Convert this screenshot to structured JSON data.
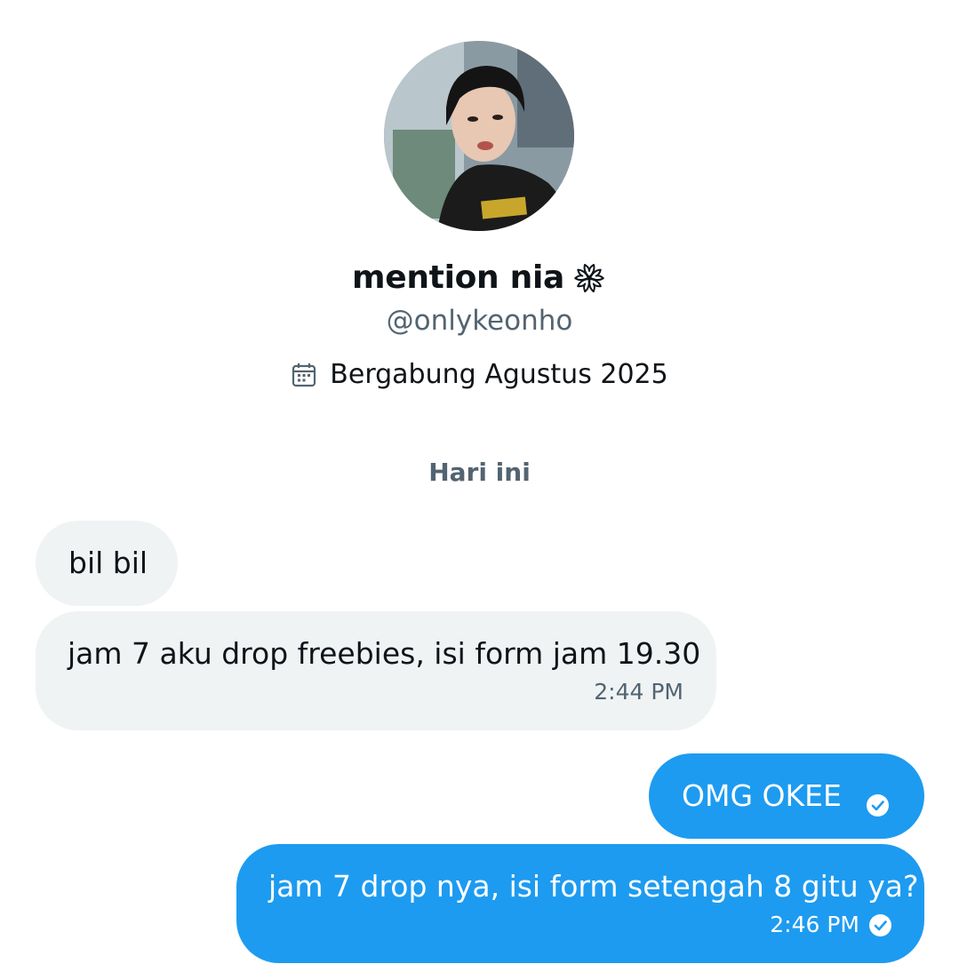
{
  "profile": {
    "display_name": "mention nia",
    "name_emoji_icon": "flower-icon",
    "handle": "@onlykeonho",
    "joined_icon": "calendar-icon",
    "joined_text": "Bergabung Agustus 2025"
  },
  "conversation": {
    "date_divider": "Hari ini",
    "messages": [
      {
        "direction": "incoming",
        "text": "bil bil"
      },
      {
        "direction": "incoming",
        "text": "jam 7 aku drop freebies, isi form jam 19.30",
        "time": "2:44 PM"
      },
      {
        "direction": "outgoing",
        "text": "OMG OKEE",
        "status_icon": "check-circle-icon"
      },
      {
        "direction": "outgoing",
        "text": "jam 7 drop nya, isi form setengah 8 gitu ya?",
        "time": "2:46 PM",
        "status_icon": "check-circle-icon"
      }
    ]
  },
  "colors": {
    "outgoing_bubble": "#1d9bf0",
    "incoming_bubble": "#eff3f4",
    "secondary_text": "#536471",
    "primary_text": "#0f1419"
  }
}
